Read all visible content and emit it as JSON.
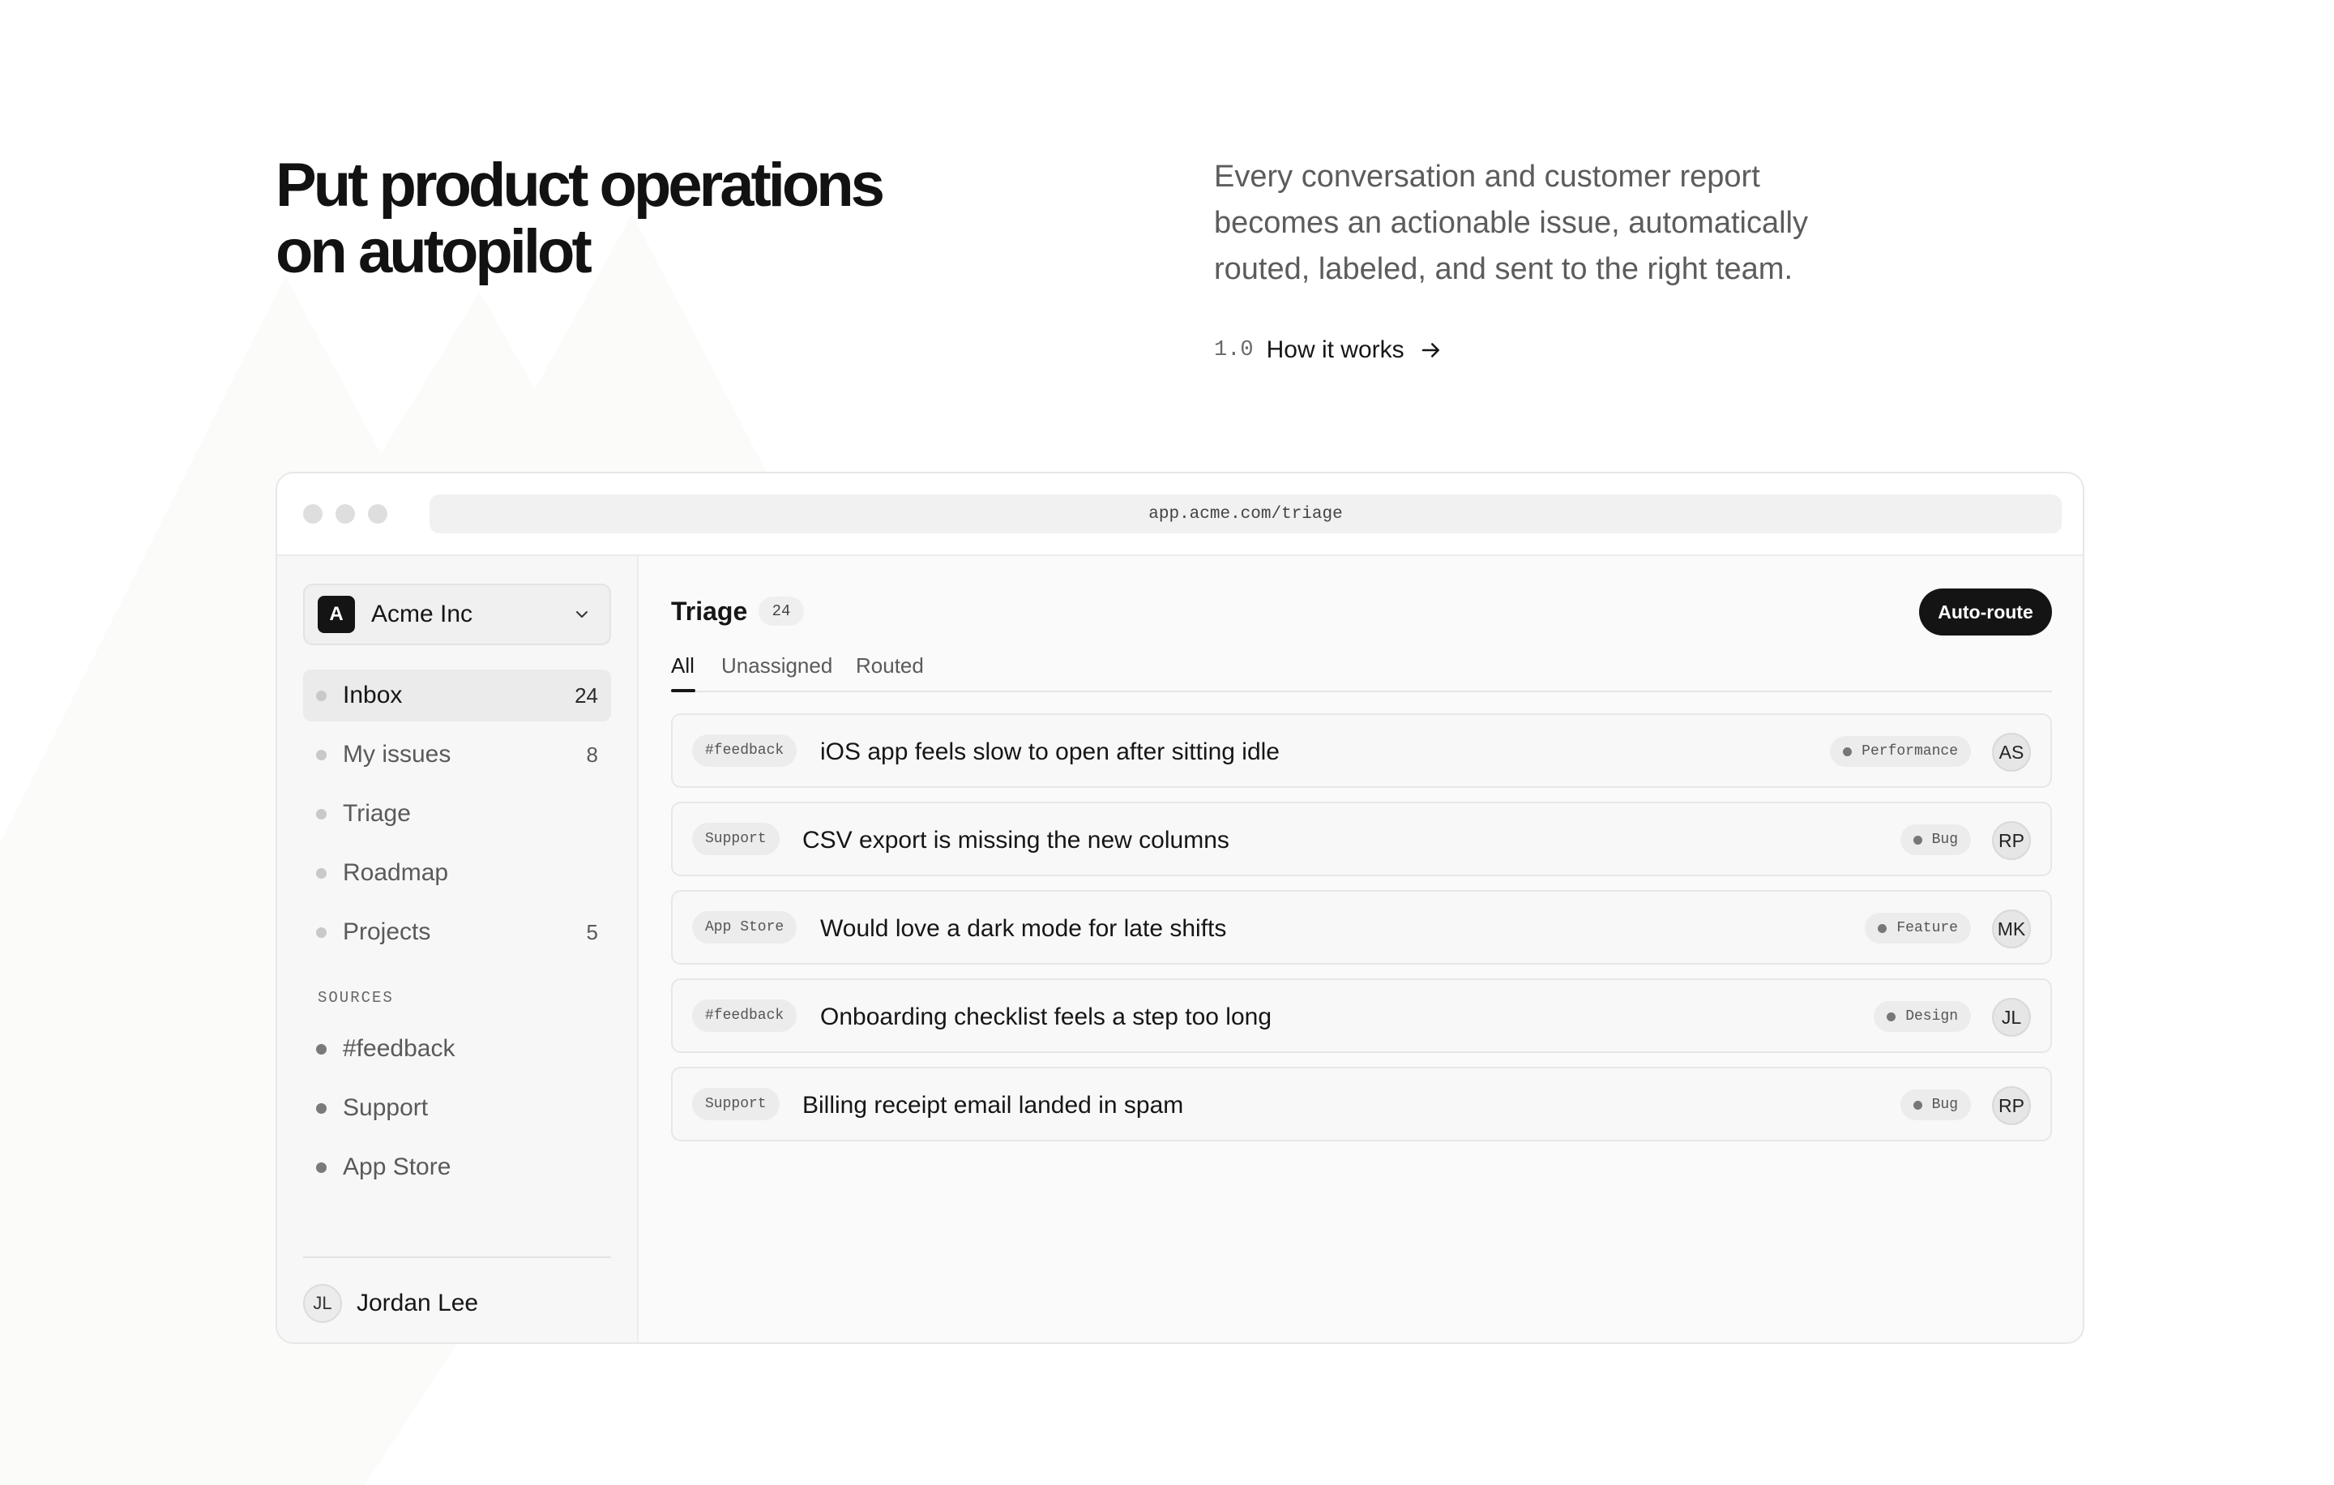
{
  "hero": {
    "title_line1": "Put product operations",
    "title_line2": "on autopilot",
    "description": "Every conversation and customer report becomes an actionable issue, automatically routed, labeled, and sent to the right team.",
    "link_number": "1.0",
    "link_label": "How it works"
  },
  "browser": {
    "url": "app.acme.com/triage"
  },
  "sidebar": {
    "workspace": {
      "logo_letter": "A",
      "name": "Acme Inc"
    },
    "nav": [
      {
        "label": "Inbox",
        "count": "24"
      },
      {
        "label": "My issues",
        "count": "8"
      },
      {
        "label": "Triage",
        "count": ""
      },
      {
        "label": "Roadmap",
        "count": ""
      },
      {
        "label": "Projects",
        "count": "5"
      }
    ],
    "sources_heading": "SOURCES",
    "sources": [
      {
        "label": "#feedback"
      },
      {
        "label": "Support"
      },
      {
        "label": "App Store"
      }
    ],
    "user": {
      "initials": "JL",
      "name": "Jordan Lee"
    }
  },
  "main": {
    "title": "Triage",
    "count": "24",
    "action_label": "Auto-route",
    "tabs": [
      {
        "label": "All"
      },
      {
        "label": "Unassigned"
      },
      {
        "label": "Routed"
      }
    ],
    "issues": [
      {
        "source": "#feedback",
        "title": "iOS app feels slow to open after sitting idle",
        "label": "Performance",
        "assignee": "AS"
      },
      {
        "source": "Support",
        "title": "CSV export is missing the new columns",
        "label": "Bug",
        "assignee": "RP"
      },
      {
        "source": "App Store",
        "title": "Would love a dark mode for late shifts",
        "label": "Feature",
        "assignee": "MK"
      },
      {
        "source": "#feedback",
        "title": "Onboarding checklist feels a step too long",
        "label": "Design",
        "assignee": "JL"
      },
      {
        "source": "Support",
        "title": "Billing receipt email landed in spam",
        "label": "Bug",
        "assignee": "RP"
      }
    ]
  }
}
